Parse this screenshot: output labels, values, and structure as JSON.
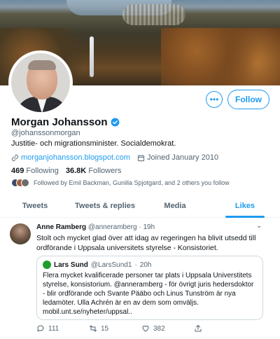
{
  "profile": {
    "name": "Morgan Johansson",
    "handle": "@johanssonmorgan",
    "bio": "Justitie- och migrationsminister. Socialdemokrat.",
    "website": "morganjohansson.blogspot.com",
    "joined": "Joined January 2010",
    "following_count": "469",
    "following_label": "Following",
    "followers_count": "36.8K",
    "followers_label": "Followers",
    "followed_by": "Followed by Emil Backman, Gunilla Spjotgard, and 2 others you follow"
  },
  "buttons": {
    "more": "•••",
    "follow": "Follow"
  },
  "tabs": [
    {
      "label": "Tweets"
    },
    {
      "label": "Tweets & replies"
    },
    {
      "label": "Media"
    },
    {
      "label": "Likes"
    }
  ],
  "tweet": {
    "author": "Anne Ramberg",
    "handle": "@anneramberg",
    "sep": "·",
    "time": "19h",
    "text": "Stolt och mycket glad över att idag av regeringen ha blivit utsedd till ordförande i Uppsala universitets styrelse - Konsistoriet.",
    "quote": {
      "author": "Lars Sund",
      "handle": "@LarsSund1",
      "sep": "·",
      "time": "20h",
      "text": "Flera mycket kvalificerade personer tar plats i Uppsala Universtitets styrelse, konsistorium. @anneramberg - för övrigt juris hedersdoktor - blir ordförande  och Svante Pääbo och Linus Tunström är nya ledamöter. Ulla Achrén är en av dem som omväljs. mobil.unt.se/nyheter/uppsal.."
    },
    "replies": "111",
    "retweets": "15",
    "likes": "382"
  },
  "colors": {
    "accent": "#1d9bf0",
    "text": "#0f1419",
    "secondary": "#536471"
  }
}
